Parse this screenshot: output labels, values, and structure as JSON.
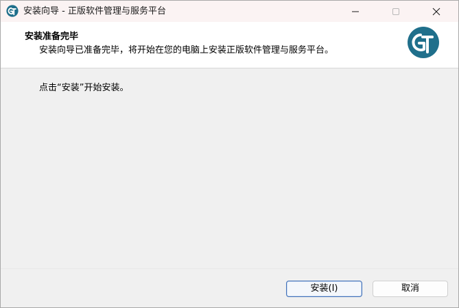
{
  "window": {
    "title": "安装向导 - 正版软件管理与服务平台",
    "icon": "gp-logo-icon"
  },
  "header": {
    "title": "安装准备完毕",
    "description": "安装向导已准备完毕，将开始在您的电脑上安装正版软件管理与服务平台。",
    "logo": "gp-logo-icon"
  },
  "body": {
    "instruction": "点击“安装”开始安装。"
  },
  "footer": {
    "install_label": "安装(I)",
    "cancel_label": "取消"
  },
  "colors": {
    "logo_bg": "#1f6f8b",
    "titlebar_bg": "#fbf3f3",
    "default_button_border": "#3f6fb8"
  }
}
